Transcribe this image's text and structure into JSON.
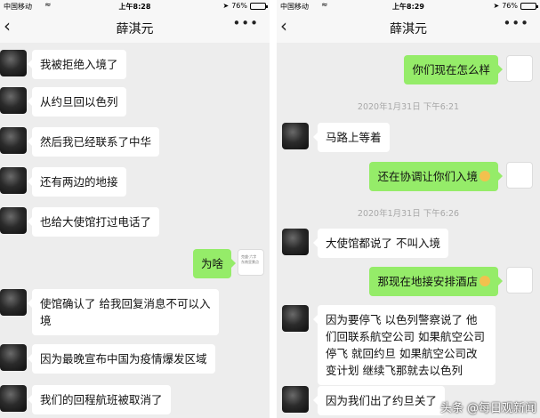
{
  "left": {
    "status": {
      "carrier": "中国移动",
      "time": "上午8:28",
      "battery": "76%",
      "battery_level": 0.76
    },
    "nav": {
      "title": "薛淇元"
    },
    "messages": [
      {
        "dir": "in",
        "text": "我被拒绝入境了"
      },
      {
        "dir": "in",
        "text": "从约旦回以色列"
      },
      {
        "dir": "in",
        "text": "然后我已经联系了中华"
      },
      {
        "dir": "in",
        "text": "还有两边的地接"
      },
      {
        "dir": "in",
        "text": "也给大使馆打过电话了"
      },
      {
        "dir": "out",
        "text": "为啥"
      },
      {
        "dir": "in",
        "text": "使馆确认了 给我回复消息不可以入境"
      },
      {
        "dir": "in",
        "text": "因为最晚宣布中国为疫情爆发区域"
      },
      {
        "dir": "in",
        "text": "我们的回程航班被取消了"
      }
    ]
  },
  "right": {
    "status": {
      "carrier": "中国移动",
      "time": "上午8:29",
      "battery": "76%",
      "battery_level": 0.76
    },
    "nav": {
      "title": "薛淇元"
    },
    "top_partial_text": "2020年1月31日 下午6:21",
    "messages": [
      {
        "dir": "out",
        "text": "你们现在怎么样"
      },
      {
        "dir": "in",
        "text": "马路上等着"
      },
      {
        "dir": "out",
        "text": "还在协调让你们入境",
        "emoji": "smile-emoji"
      },
      {
        "dir": "in",
        "text": "大使馆都说了 不叫入境"
      },
      {
        "dir": "out",
        "text": "那现在地接安排酒店",
        "emoji": "smile-emoji"
      },
      {
        "dir": "in",
        "text": "因为要停飞 以色列警察说了 他们回联系航空公司 如果航空公司停飞 就回约旦 如果航空公司改变计划 继续飞那就去以色列"
      },
      {
        "dir": "in",
        "text": "因为我们出了约旦关了"
      }
    ],
    "timestamps": [
      "2020年1月31日 下午6:21",
      "2020年1月31日 下午6:26"
    ]
  },
  "avatar_note": "克盛·六字 东南亚景点",
  "watermark": "头条 @每日观新闻"
}
